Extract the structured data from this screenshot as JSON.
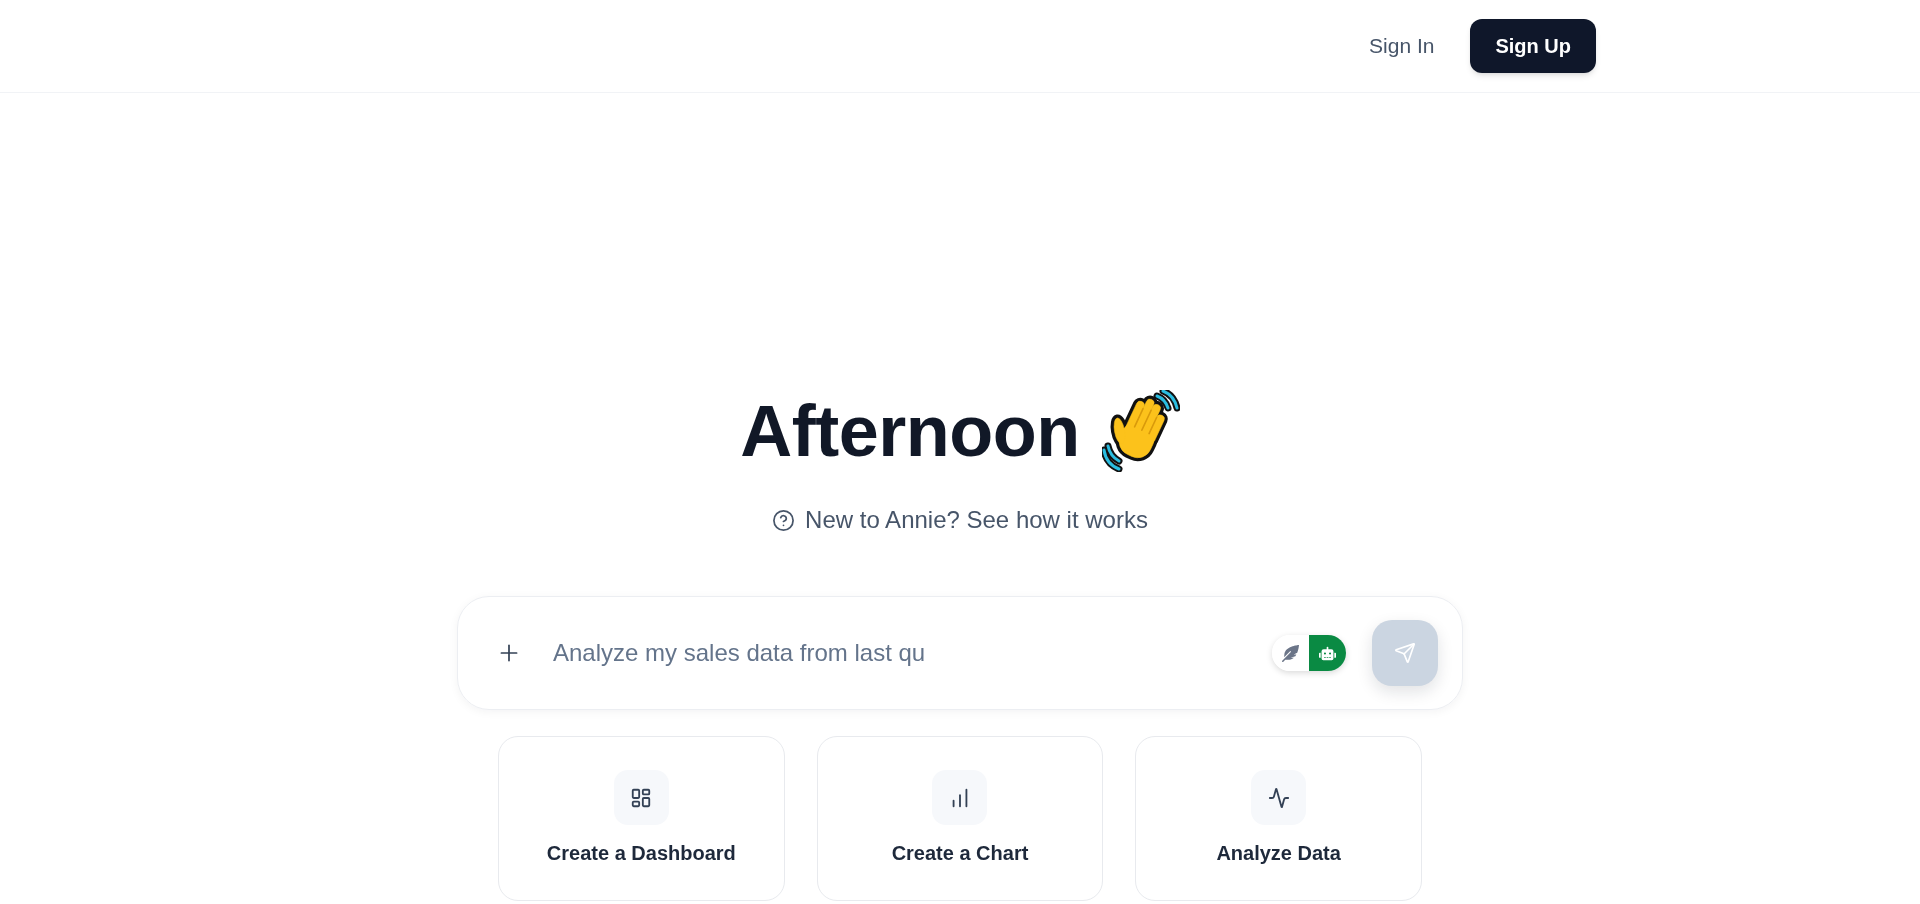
{
  "header": {
    "links": [
      {
        "label": "Sign In",
        "kind": "link"
      },
      {
        "label": "Sign Up",
        "kind": "primary"
      }
    ]
  },
  "hero": {
    "title": "Afternoon",
    "help_link": "New to Annie? See how it works"
  },
  "composer": {
    "placeholder": "Analyze my sales data from last qu",
    "modes": [
      {
        "kind": "feather",
        "selected": false
      },
      {
        "kind": "robot",
        "selected": true
      }
    ],
    "send": {
      "disabled": true
    }
  },
  "actions": [
    {
      "kind": "dashboard",
      "label": "Create a Dashboard"
    },
    {
      "kind": "chart",
      "label": "Create a Chart"
    },
    {
      "kind": "analyze",
      "label": "Analyze Data"
    }
  ]
}
